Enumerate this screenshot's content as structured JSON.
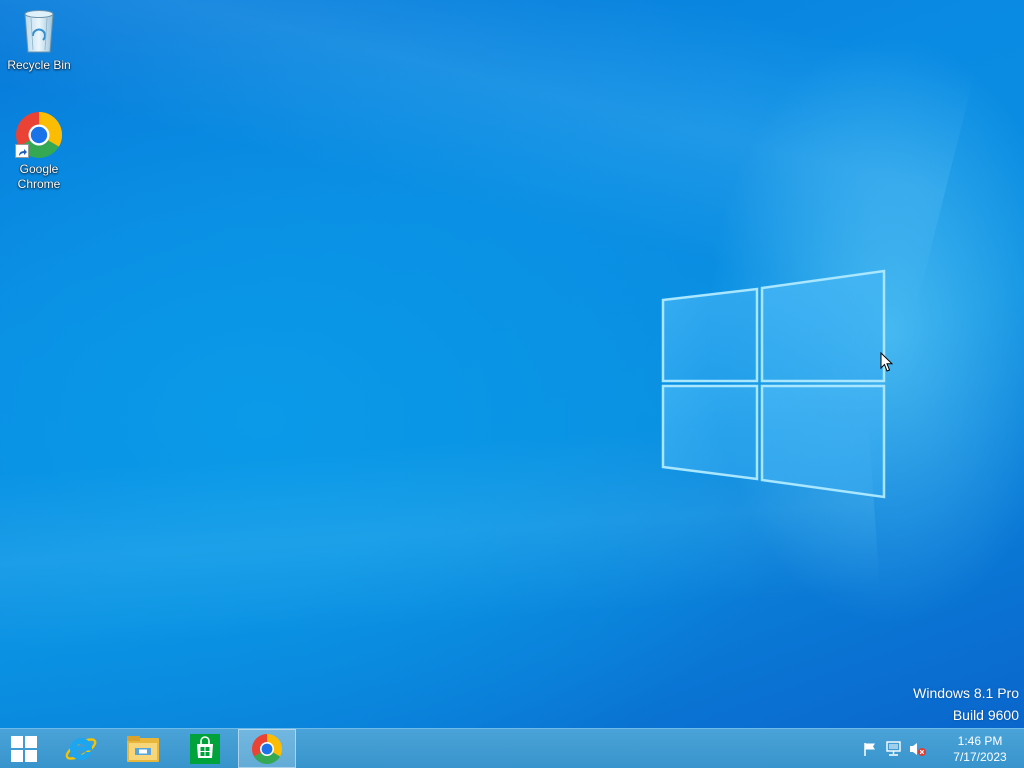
{
  "desktop": {
    "icons": [
      {
        "label": "Recycle Bin",
        "icon": "recycle-bin-icon"
      },
      {
        "label": "Google\nChrome",
        "icon": "chrome-icon"
      }
    ],
    "watermark": {
      "edition": "Windows 8.1 Pro",
      "build": "Build 9600"
    }
  },
  "taskbar": {
    "pinned": [
      {
        "name": "start",
        "icon": "windows-start-icon"
      },
      {
        "name": "internet-explorer",
        "icon": "internet-explorer-icon"
      },
      {
        "name": "file-explorer",
        "icon": "file-explorer-icon"
      },
      {
        "name": "store",
        "icon": "store-icon"
      },
      {
        "name": "chrome",
        "icon": "chrome-icon",
        "active": true
      }
    ],
    "tray": {
      "icons": [
        "action-center-flag-icon",
        "network-icon",
        "volume-muted-icon"
      ],
      "time": "1:46 PM",
      "date": "7/17/2023"
    }
  },
  "colors": {
    "wallpaper": "#0a8ee0",
    "taskbar": "#3e9ad0",
    "logo_glow": "#8fdcff"
  }
}
